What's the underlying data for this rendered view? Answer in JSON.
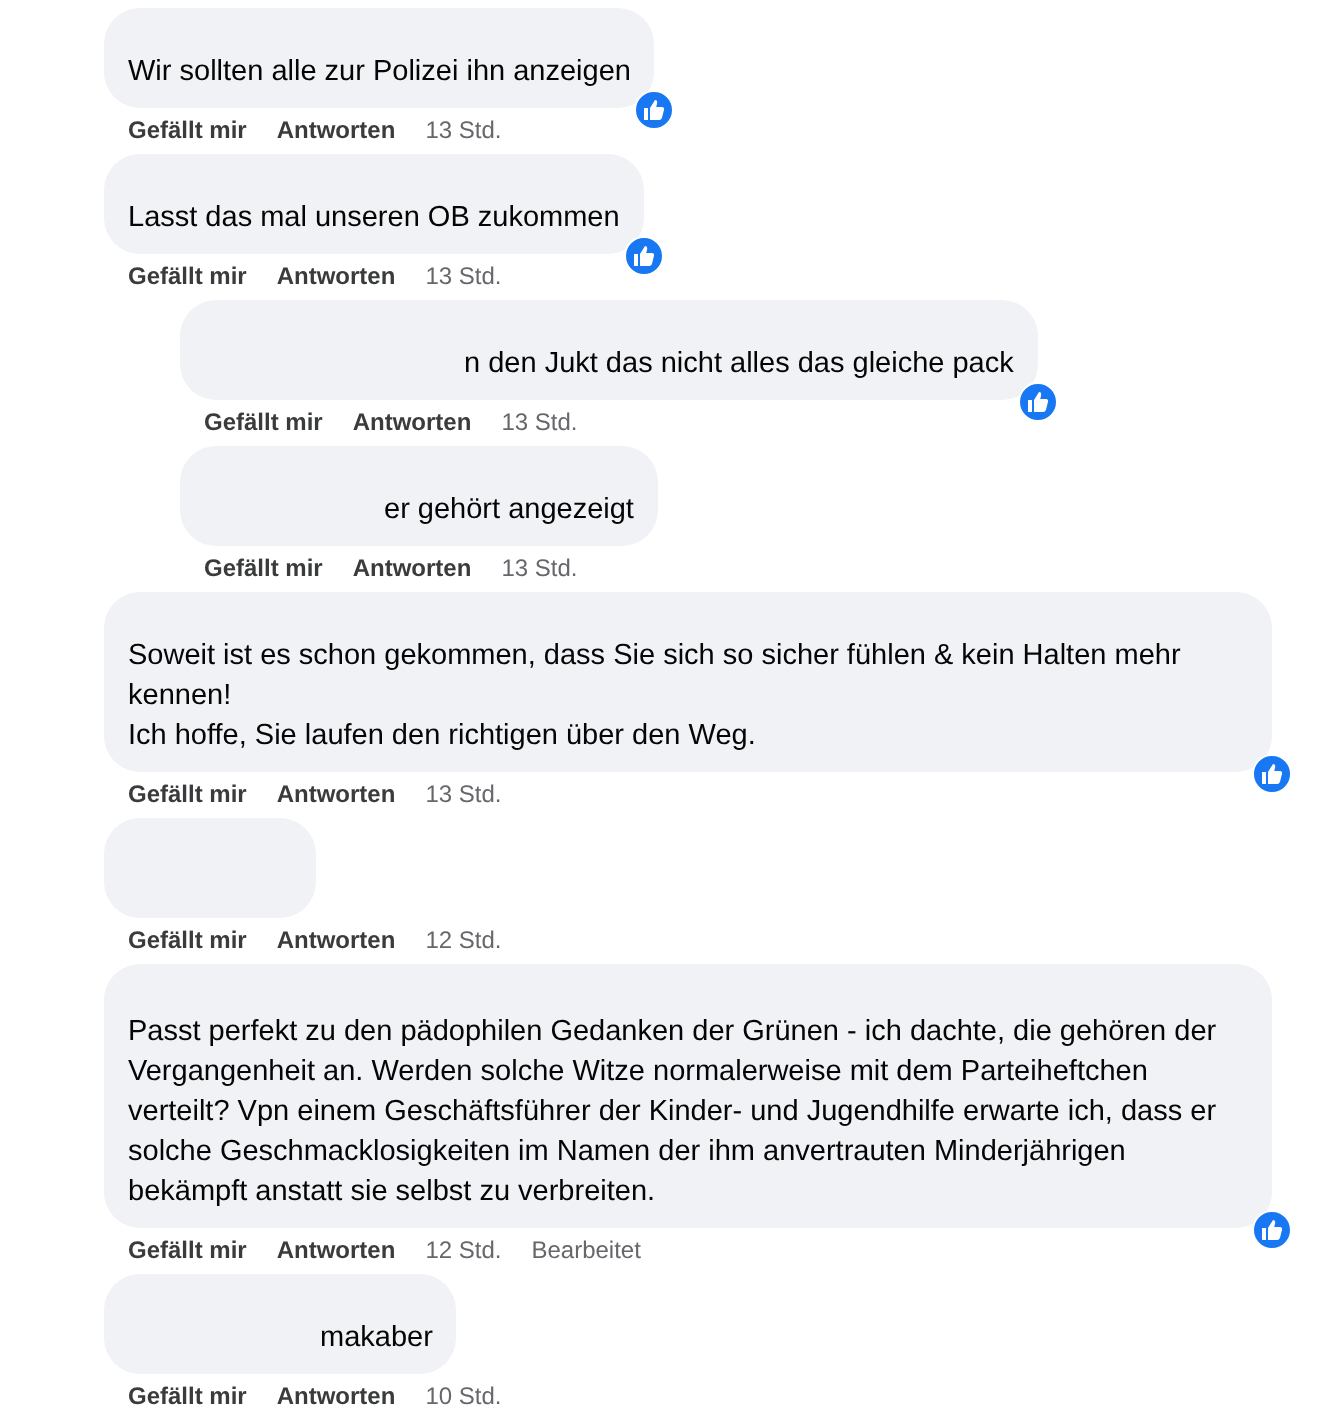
{
  "comments": [
    {
      "kind": "comment",
      "text": "Wir sollten alle zur Polizei ihn anzeigen",
      "liked": true,
      "like_action": "Gefällt mir",
      "reply_action": "Antworten",
      "time": "13 Std."
    },
    {
      "kind": "comment",
      "text": "Lasst das mal unseren OB zukommen",
      "liked": true,
      "like_action": "Gefällt mir",
      "reply_action": "Antworten",
      "time": "13 Std."
    },
    {
      "kind": "reply",
      "text": "n den Jukt das nicht alles das gleiche pack",
      "liked": true,
      "like_action": "Gefällt mir",
      "reply_action": "Antworten",
      "time": "13 Std."
    },
    {
      "kind": "reply",
      "text": "er gehört angezeigt",
      "liked": false,
      "like_action": "Gefällt mir",
      "reply_action": "Antworten",
      "time": "13 Std."
    },
    {
      "kind": "comment",
      "text": "Soweit ist es schon gekommen, dass Sie sich so sicher fühlen & kein Halten mehr kennen!\nIch hoffe, Sie laufen den richtigen über den Weg.",
      "liked": true,
      "like_action": "Gefällt mir",
      "reply_action": "Antworten",
      "time": "13 Std."
    },
    {
      "kind": "comment",
      "liked": false,
      "like_action": "Gefällt mir",
      "reply_action": "Antworten",
      "time": "12 Std."
    },
    {
      "kind": "comment",
      "text": "Passt perfekt zu den pädophilen Gedanken der Grünen - ich dachte, die gehören der Vergangenheit an. Werden solche Witze normalerweise mit dem Parteiheftchen verteilt? Vpn einem Geschäftsführer der Kinder- und Jugendhilfe erwarte ich, dass er solche Geschmacklosigkeiten im Namen der ihm anvertrauten Minderjährigen bekämpft anstatt sie selbst zu verbreiten.",
      "liked": true,
      "like_action": "Gefällt mir",
      "reply_action": "Antworten",
      "time": "12 Std.",
      "edited": "Bearbeitet"
    },
    {
      "kind": "comment",
      "text": "makaber",
      "liked": false,
      "like_action": "Gefällt mir",
      "reply_action": "Antworten",
      "time": "10 Std."
    }
  ]
}
